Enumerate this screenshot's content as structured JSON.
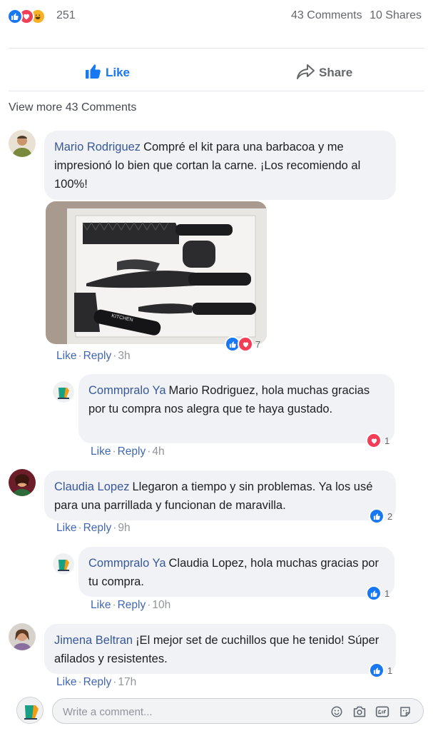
{
  "summary": {
    "reaction_count": "251",
    "comments_count": "43 Comments",
    "shares_count": "10 Shares",
    "reaction_icons": [
      "like-icon",
      "love-icon",
      "haha-icon"
    ]
  },
  "actions": {
    "like_label": "Like",
    "share_label": "Share"
  },
  "view_more": "View more 43 Comments",
  "links": {
    "like": "Like",
    "reply": "Reply"
  },
  "comments": [
    {
      "author": "Mario Rodriguez",
      "text": "Compré el kit para una barbacoa y me impresionó lo bien que cortan la carne. ¡Los recomiendo al 100%!",
      "time": "3h",
      "reactions": "7",
      "photo_brand": "KITCHEN"
    },
    {
      "author": "Commpralo Ya",
      "text": "Mario Rodriguez, hola muchas gracias por tu compra nos alegra que te haya gustado.",
      "time": "4h",
      "reactions": "1"
    },
    {
      "author": "Claudia Lopez",
      "text": "Llegaron a tiempo y sin problemas. Ya los usé para una parrillada y funcionan de maravilla.",
      "time": "9h",
      "reactions": "2"
    },
    {
      "author": "Commpralo Ya",
      "text": "Claudia Lopez, hola muchas gracias por tu compra.",
      "time": "10h",
      "reactions": "1"
    },
    {
      "author": "Jimena Beltran",
      "text": "¡El mejor set de cuchillos que he tenido! Súper afilados y resistentes.",
      "time": "17h",
      "reactions": "1"
    }
  ],
  "composer": {
    "placeholder": "Write a comment...",
    "tools": [
      "emoji-icon",
      "camera-icon",
      "gif-icon",
      "sticker-icon"
    ]
  },
  "colors": {
    "like_blue": "#1877f2",
    "love_red": "#f33e58",
    "haha_yellow": "#f7b125",
    "author_link": "#385898",
    "bubble_bg": "#f0f2f5"
  }
}
